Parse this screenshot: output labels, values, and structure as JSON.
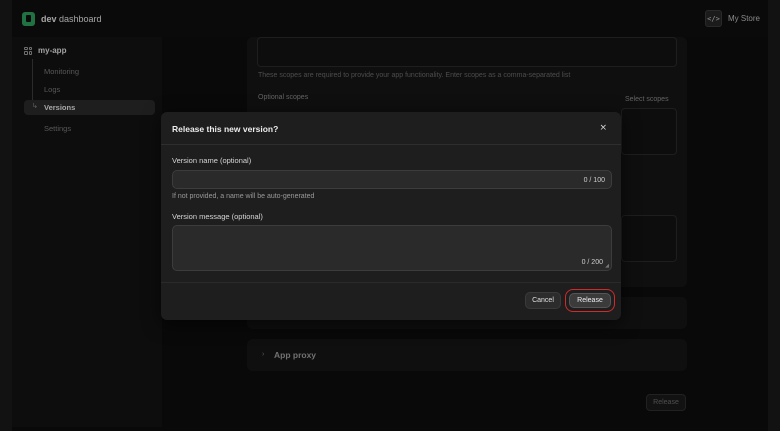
{
  "topbar": {
    "brand_bold": "dev",
    "brand_rest": " dashboard",
    "store_icon": "code-icon",
    "store_label": "My Store"
  },
  "sidebar": {
    "app_name": "my-app",
    "items": [
      {
        "label": "Monitoring"
      },
      {
        "label": "Logs"
      },
      {
        "label": "Versions",
        "active": true
      },
      {
        "label": "Settings"
      }
    ]
  },
  "background": {
    "scopes_help": "These scopes are required to provide your app functionality. Enter scopes as a comma-separated list",
    "optional_scopes_label": "Optional scopes",
    "select_scopes_link": "Select scopes",
    "app_proxy_label": "App proxy",
    "release_button": "Release"
  },
  "modal": {
    "title": "Release this new version?",
    "close_glyph": "×",
    "version_name_label": "Version name (optional)",
    "version_name_value": "",
    "version_name_counter": "0 / 100",
    "version_name_help": "If not provided, a name will be auto-generated",
    "version_message_label": "Version message (optional)",
    "version_message_value": "",
    "version_message_counter": "0 / 200",
    "cancel_label": "Cancel",
    "release_label": "Release"
  },
  "colors": {
    "accent_highlight": "#d12a2a",
    "brand": "#2e9e5e"
  }
}
